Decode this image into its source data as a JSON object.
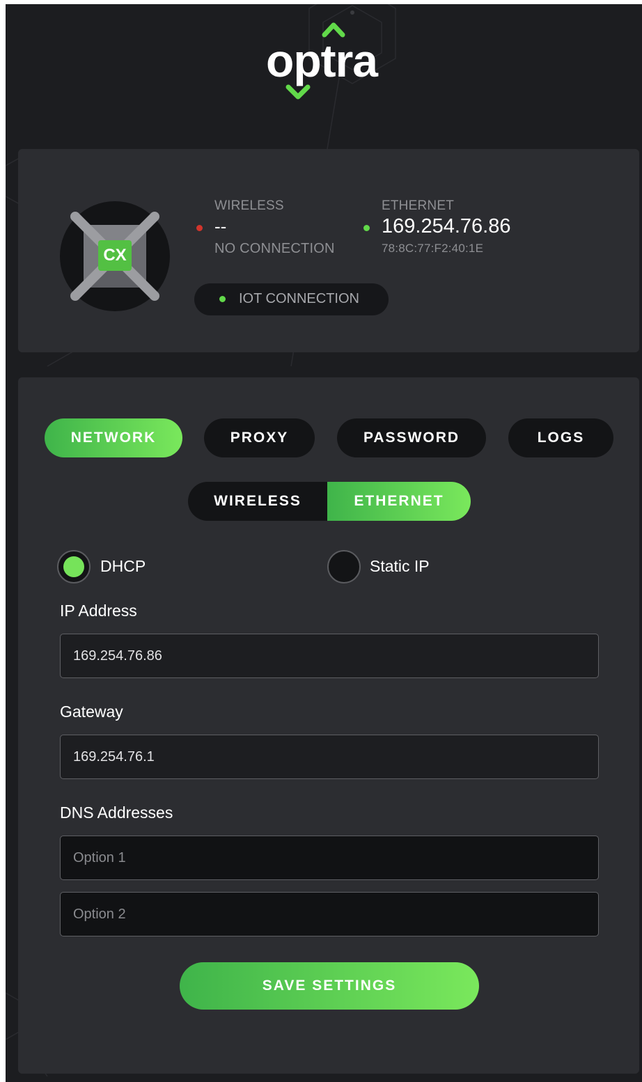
{
  "brand": {
    "logo_text": "optra",
    "accent": "#62d94a"
  },
  "status": {
    "device_badge": "CX",
    "wireless": {
      "label": "WIRELESS",
      "value": "--",
      "sub": "NO CONNECTION",
      "dot_color": "#d2352c"
    },
    "ethernet": {
      "label": "ETHERNET",
      "value": "169.254.76.86",
      "sub": "78:8C:77:F2:40:1E",
      "dot_color": "#62d94a"
    },
    "iot": {
      "label": "IOT CONNECTION",
      "dot_color": "#62d94a"
    }
  },
  "tabs": [
    {
      "label": "NETWORK",
      "active": true
    },
    {
      "label": "PROXY",
      "active": false
    },
    {
      "label": "PASSWORD",
      "active": false
    },
    {
      "label": "LOGS",
      "active": false
    }
  ],
  "interface_toggle": [
    {
      "label": "WIRELESS",
      "active": false
    },
    {
      "label": "ETHERNET",
      "active": true
    }
  ],
  "mode": {
    "dhcp_label": "DHCP",
    "static_label": "Static IP",
    "selected": "DHCP"
  },
  "form": {
    "ip_label": "IP Address",
    "ip_value": "169.254.76.86",
    "gateway_label": "Gateway",
    "gateway_value": "169.254.76.1",
    "dns_label": "DNS Addresses",
    "dns1_placeholder": "Option 1",
    "dns2_placeholder": "Option 2"
  },
  "save_label": "SAVE SETTINGS"
}
